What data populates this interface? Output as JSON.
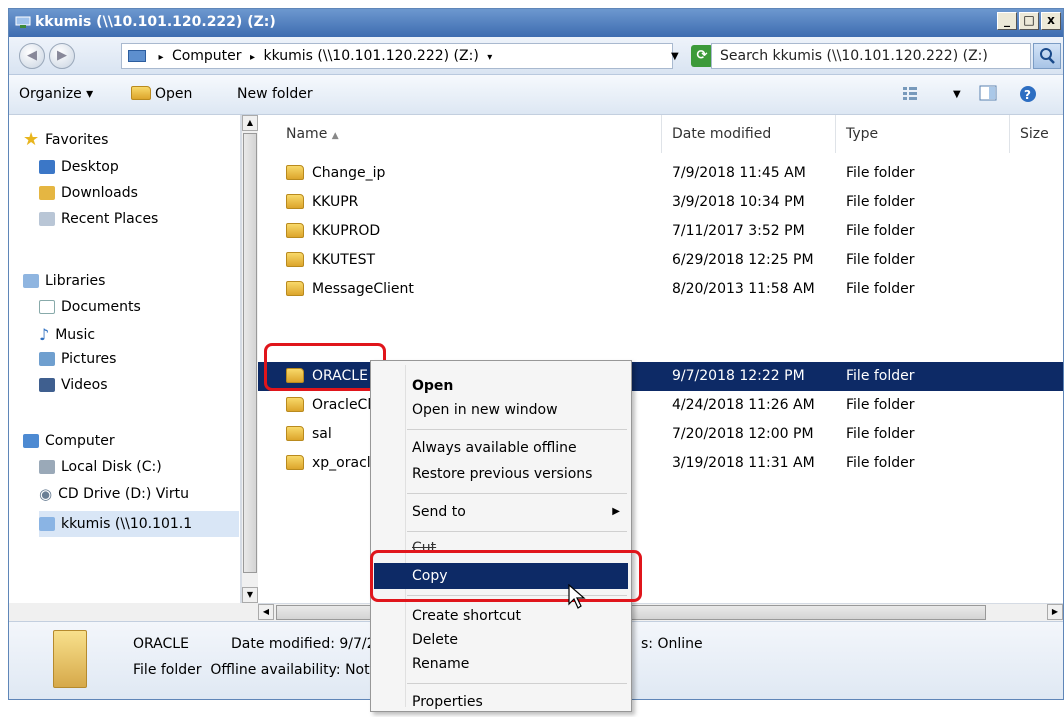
{
  "window": {
    "title": "kkumis (\\\\10.101.120.222) (Z:)",
    "min": "_",
    "max": "□",
    "close": "x"
  },
  "address": {
    "crumbs": [
      "Computer",
      "kkumis (\\\\10.101.120.222) (Z:)"
    ],
    "search_placeholder": "Search kkumis (\\\\10.101.120.222) (Z:)"
  },
  "toolbar": {
    "organize": "Organize ▾",
    "open": "Open",
    "new_folder": "New folder"
  },
  "nav": {
    "favorites": "Favorites",
    "desktop": "Desktop",
    "downloads": "Downloads",
    "recent": "Recent Places",
    "libraries": "Libraries",
    "documents": "Documents",
    "music": "Music",
    "pictures": "Pictures",
    "videos": "Videos",
    "computer": "Computer",
    "local_disk": "Local Disk (C:)",
    "cd_drive": "CD Drive (D:) Virtu",
    "kkumis": "kkumis (\\\\10.101.1"
  },
  "columns": {
    "name": "Name",
    "date": "Date modified",
    "type": "Type",
    "size": "Size"
  },
  "files": [
    {
      "name": "Change_ip",
      "date": "7/9/2018 11:45 AM",
      "type": "File folder"
    },
    {
      "name": "KKUPR",
      "date": "3/9/2018 10:34 PM",
      "type": "File folder"
    },
    {
      "name": "KKUPROD",
      "date": "7/11/2017 3:52 PM",
      "type": "File folder"
    },
    {
      "name": "KKUTEST",
      "date": "6/29/2018 12:25 PM",
      "type": "File folder"
    },
    {
      "name": "MessageClient",
      "date": "8/20/2013 11:58 AM",
      "type": "File folder"
    },
    {
      "name": "ORACLE",
      "date": "9/7/2018 12:22 PM",
      "type": "File folder"
    },
    {
      "name": "OracleClien",
      "date": "4/24/2018 11:26 AM",
      "type": "File folder"
    },
    {
      "name": "sal",
      "date": "7/20/2018 12:00 PM",
      "type": "File folder"
    },
    {
      "name": "xp_oracle_",
      "date": "3/19/2018 11:31 AM",
      "type": "File folder"
    }
  ],
  "details": {
    "name": "ORACLE",
    "date_label": "Date modified: 9/7/2",
    "line2": "File folder  Offline availability: Not a",
    "status": "s: Online"
  },
  "menu": {
    "open": "Open",
    "open_new": "Open in new window",
    "offline": "Always available offline",
    "restore": "Restore previous versions",
    "send_to": "Send to",
    "cut": "Cut",
    "copy": "Copy",
    "shortcut": "Create shortcut",
    "delete": "Delete",
    "rename": "Rename",
    "properties": "Properties"
  },
  "colors": {
    "selection": "#0d2a66",
    "highlight_box": "#e0151b"
  }
}
